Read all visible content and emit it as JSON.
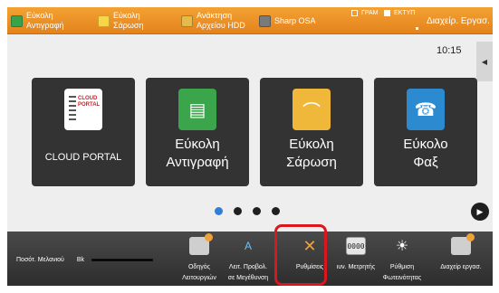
{
  "topbar": {
    "shortcuts": [
      {
        "label_line1": "Εύκολη",
        "label_line2": "Αντιγραφή",
        "icon": "easy-copy-icon"
      },
      {
        "label_line1": "Εύκολη",
        "label_line2": "Σάρωση",
        "icon": "easy-scan-icon"
      },
      {
        "label_line1": "Ανάκτηση",
        "label_line2": "Αρχείου HDD",
        "icon": "hdd-folder-icon"
      },
      {
        "label_line1": "Sharp OSA",
        "label_line2": "",
        "icon": "sharp-osa-icon"
      }
    ],
    "mode_print": "ΓΡΑΜ",
    "mode_print_label2": "ΕΚΤΥΠ",
    "job_status_label": "Διαχείρ. Εργασ."
  },
  "main": {
    "clock": "10:15",
    "side_tab_icon": "collapse-left-icon",
    "tiles": [
      {
        "label_line1": "CLOUD PORTAL",
        "label_line2": "",
        "icon": "cloud-portal-icon",
        "logo_text_1": "CLOUD",
        "logo_text_2": "PORTAL"
      },
      {
        "label_line1": "Εύκολη",
        "label_line2": "Αντιγραφή",
        "icon": "easy-copy-icon"
      },
      {
        "label_line1": "Εύκολη",
        "label_line2": "Σάρωση",
        "icon": "easy-scan-icon"
      },
      {
        "label_line1": "Εύκολο",
        "label_line2": "Φαξ",
        "icon": "easy-fax-icon"
      }
    ],
    "pager": {
      "pages": 4,
      "current": 1
    },
    "next_icon": "next-page-icon"
  },
  "bottombar": {
    "toner_label": "Ποσότ. Μελανιού",
    "toner_color": "Bk",
    "tools": [
      {
        "label_line1": "Οδηγός",
        "label_line2": "Λειτουργιών",
        "icon": "operation-guide-icon"
      },
      {
        "label_line1": "Λειτ. Προβολ.",
        "label_line2": "σε Μεγέθυνση",
        "icon": "enlarge-display-icon",
        "glyph": "A"
      },
      {
        "label_line1": "Ρυθμίσεις",
        "label_line2": "",
        "icon": "settings-icon",
        "glyph": "✕"
      },
      {
        "label_line1": "ιυν. Μετρητής",
        "label_line2": "",
        "icon": "total-count-icon",
        "glyph": "0000"
      },
      {
        "label_line1": "Ρύθμιση",
        "label_line2": "Φωτεινότητας",
        "icon": "brightness-icon",
        "glyph": "☀"
      },
      {
        "label_line1": "Διαχείρ εργασ.",
        "label_line2": "",
        "icon": "job-status-icon"
      }
    ]
  },
  "colors": {
    "topbar": "#e9901f",
    "highlight": "#d8171e",
    "tile": "#333333",
    "pager_active": "#2f7fd6"
  }
}
